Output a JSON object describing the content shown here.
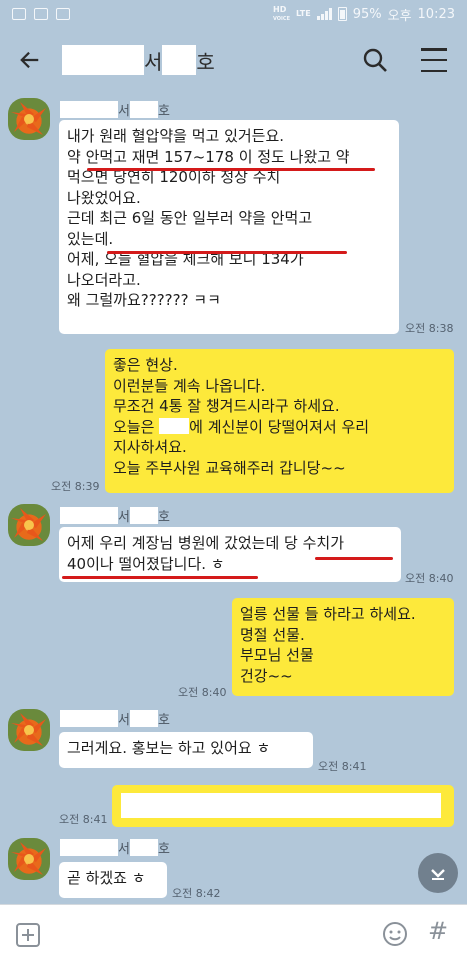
{
  "status_bar": {
    "hd": "HD",
    "voice": "VOICE",
    "lte": "LTE",
    "battery": "95%",
    "ampm": "오후",
    "time": "10:23"
  },
  "header": {
    "title": "서",
    "title_suffix": "호"
  },
  "messages": [
    {
      "sender_mid": "서",
      "sender_end": "호",
      "text": "내가 원래 혈압약을 먹고 있거든요.\n약 안먹고 재면 157~178 이 정도 나왔고 약\n먹으면 당연히 120이하 정상 수치\n나왔었어요.\n근데 최근 6일 동안 일부러 약을 안먹고\n있는데.\n어제, 오늘 혈압을 체크해 보니 134가\n나오더라고.\n왜 그럴까요?????? ㅋㅋ",
      "time": "오전 8:38"
    },
    {
      "text_before": "좋은 현상.\n이런분들 계속 나옵니다.\n무조건 4통 잘 챙겨드시라구 하세요.\n오늘은 ",
      "text_after": "에 계신분이 당떨어져서 우리\n지사하셔요.\n오늘 주부사원 교육해주러 갑니당~~",
      "time": "오전 8:39"
    },
    {
      "sender_mid": "서",
      "sender_end": "호",
      "text": "어제 우리 계장님 병원에 갔었는데 당 수치가\n40이나 떨어졌답니다. ㅎ",
      "time": "오전 8:40"
    },
    {
      "text": "얼릉 선물 들 하라고 하세요.\n명절 선물.\n부모님 선물\n건강~~",
      "time": "오전 8:40"
    },
    {
      "sender_mid": "서",
      "sender_end": "호",
      "text": "그러게요. 홍보는 하고 있어요 ㅎ",
      "time": "오전 8:41"
    },
    {
      "time": "오전 8:41"
    },
    {
      "sender_mid": "서",
      "sender_end": "호",
      "text": "곧 하겠죠 ㅎ",
      "time": "오전 8:42"
    }
  ],
  "colors": {
    "background": "#b2c7d9",
    "my_bubble": "#fde93b",
    "their_bubble": "#ffffff",
    "underline": "#d41a1a"
  }
}
